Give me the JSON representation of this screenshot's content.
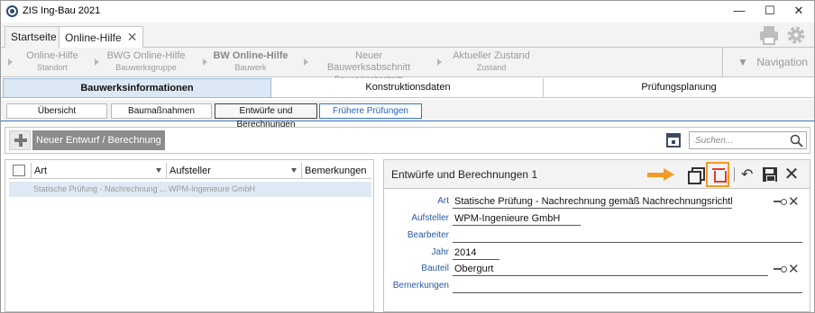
{
  "window": {
    "title": "ZIS Ing-Bau 2021",
    "minimize": "—",
    "maximize": "☐",
    "close": "✕"
  },
  "tabs": [
    {
      "label": "Startseite"
    },
    {
      "label": "Online-Hilfe",
      "close": "✕"
    }
  ],
  "breadcrumb": [
    {
      "title": "Online-Hilfe",
      "sub": "Standort"
    },
    {
      "title": "BWG Online-Hilfe",
      "sub": "Bauwerksgruppe"
    },
    {
      "title": "BW Online-Hilfe",
      "sub": "Bauwerk"
    },
    {
      "title": "Neuer Bauwerksabschnitt",
      "sub": "Bauwerksabschnitt"
    },
    {
      "title": "Aktueller Zustand",
      "sub": "Zustand"
    }
  ],
  "navigation": {
    "label": "Navigation",
    "arrow": "▼"
  },
  "sections": [
    "Bauwerksinformationen",
    "Konstruktionsdaten",
    "Prüfungsplanung"
  ],
  "subtabs": [
    "Übersicht",
    "Baumaßnahmen",
    "Entwürfe und Berechnungen",
    "Frühere Prüfungen"
  ],
  "toolbar": {
    "new_label": "Neuer Entwurf / Berechnung",
    "search_placeholder": "Suchen..."
  },
  "list": {
    "columns": [
      "Art",
      "Aufsteller",
      "Bemerkungen"
    ],
    "rows": [
      {
        "art": "Statische Prüfung - Nachrechnung ...",
        "aufsteller": "WPM-Ingenieure GmbH",
        "bemerkungen": ""
      }
    ]
  },
  "detail": {
    "title": "Entwürfe und Berechnungen 1",
    "undo": "↶",
    "close": "✕",
    "fields": {
      "art": {
        "label": "Art",
        "value": "Statische Prüfung - Nachrechnung gemäß Nachrechnungsrichtlinie"
      },
      "aufsteller": {
        "label": "Aufsteller",
        "value": "WPM-Ingenieure GmbH"
      },
      "bearbeiter": {
        "label": "Bearbeiter",
        "value": ""
      },
      "jahr": {
        "label": "Jahr",
        "value": "2014"
      },
      "bauteil": {
        "label": "Bauteil",
        "value": "Obergurt"
      },
      "bemerkungen": {
        "label": "Bemerkungen",
        "value": ""
      }
    },
    "clear": "✕"
  },
  "colors": {
    "accent": "#f39a24",
    "delete": "#e53a2a",
    "label_blue": "#2a5aa0",
    "selection": "#dfe9f5"
  },
  "icons": [
    "app-icon",
    "print-icon",
    "settings-gear-icon",
    "plus-icon",
    "calendar-icon",
    "search-icon",
    "filter-icon",
    "column-config-icon",
    "arrow-right-icon",
    "copy-icon",
    "trash-icon",
    "undo-icon",
    "save-icon",
    "close-icon",
    "key-icon"
  ]
}
